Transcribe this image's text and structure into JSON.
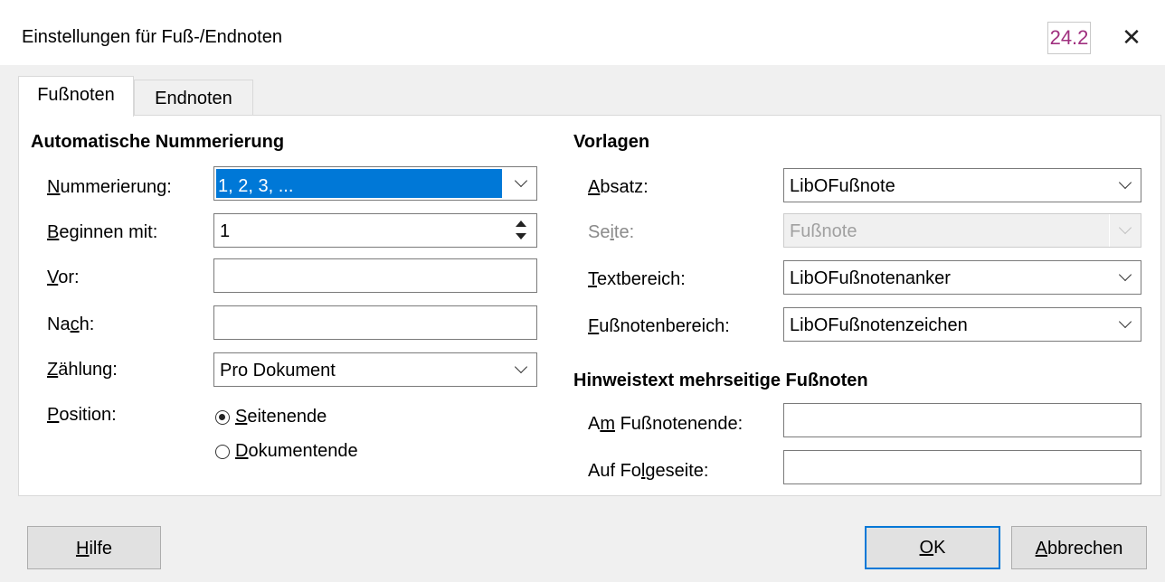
{
  "window": {
    "title": "Einstellungen für Fuß-/Endnoten",
    "version": "24.2",
    "close_icon": "close-icon"
  },
  "tabs": [
    {
      "label": "Fußnoten",
      "active": true
    },
    {
      "label": "Endnoten",
      "active": false
    }
  ],
  "numbering": {
    "heading": "Automatische Nummerierung",
    "nummerierung": {
      "label_u": "N",
      "label_rest": "ummerierung:",
      "value": "1, 2, 3, ..."
    },
    "beginnen": {
      "label_u": "B",
      "label_rest": "eginnen mit:",
      "value": "1"
    },
    "vor": {
      "label_u": "V",
      "label_rest": "or:",
      "value": ""
    },
    "nach": {
      "label_pre": "Na",
      "label_u": "c",
      "label_rest": "h:",
      "value": ""
    },
    "zaehlung": {
      "label_u": "Z",
      "label_rest": "ählung:",
      "value": "Pro Dokument"
    },
    "position": {
      "label_u": "P",
      "label_rest": "osition:",
      "options": [
        {
          "label_u": "S",
          "label_rest": "eitenende",
          "selected": true
        },
        {
          "label_u": "D",
          "label_rest": "okumentende",
          "selected": false
        }
      ]
    }
  },
  "templates": {
    "heading": "Vorlagen",
    "absatz": {
      "label_u": "A",
      "label_rest": "bsatz:",
      "value": "LibOFußnote"
    },
    "seite": {
      "label_pre": "Se",
      "label_u": "i",
      "label_rest": "te:",
      "value": "Fußnote",
      "disabled": true
    },
    "textbereich": {
      "label_u": "T",
      "label_rest": "extbereich:",
      "value": "LibOFußnotenanker"
    },
    "fussnotenbereich": {
      "label_u": "F",
      "label_rest": "ußnotenbereich:",
      "value": "LibOFußnotenzeichen"
    }
  },
  "continuation": {
    "heading": "Hinweistext mehrseitige Fußnoten",
    "am_ende": {
      "label_pre": "A",
      "label_u": "m",
      "label_rest": " Fußnotenende:",
      "value": ""
    },
    "folgeseite": {
      "label_pre": "Auf Fo",
      "label_u": "l",
      "label_rest": "geseite:",
      "value": ""
    }
  },
  "buttons": {
    "hilfe": {
      "label_u": "H",
      "label_rest": "ilfe"
    },
    "ok": {
      "label_u": "O",
      "label_rest": "K"
    },
    "abbrechen": {
      "label_u": "A",
      "label_rest": "bbrechen"
    }
  }
}
